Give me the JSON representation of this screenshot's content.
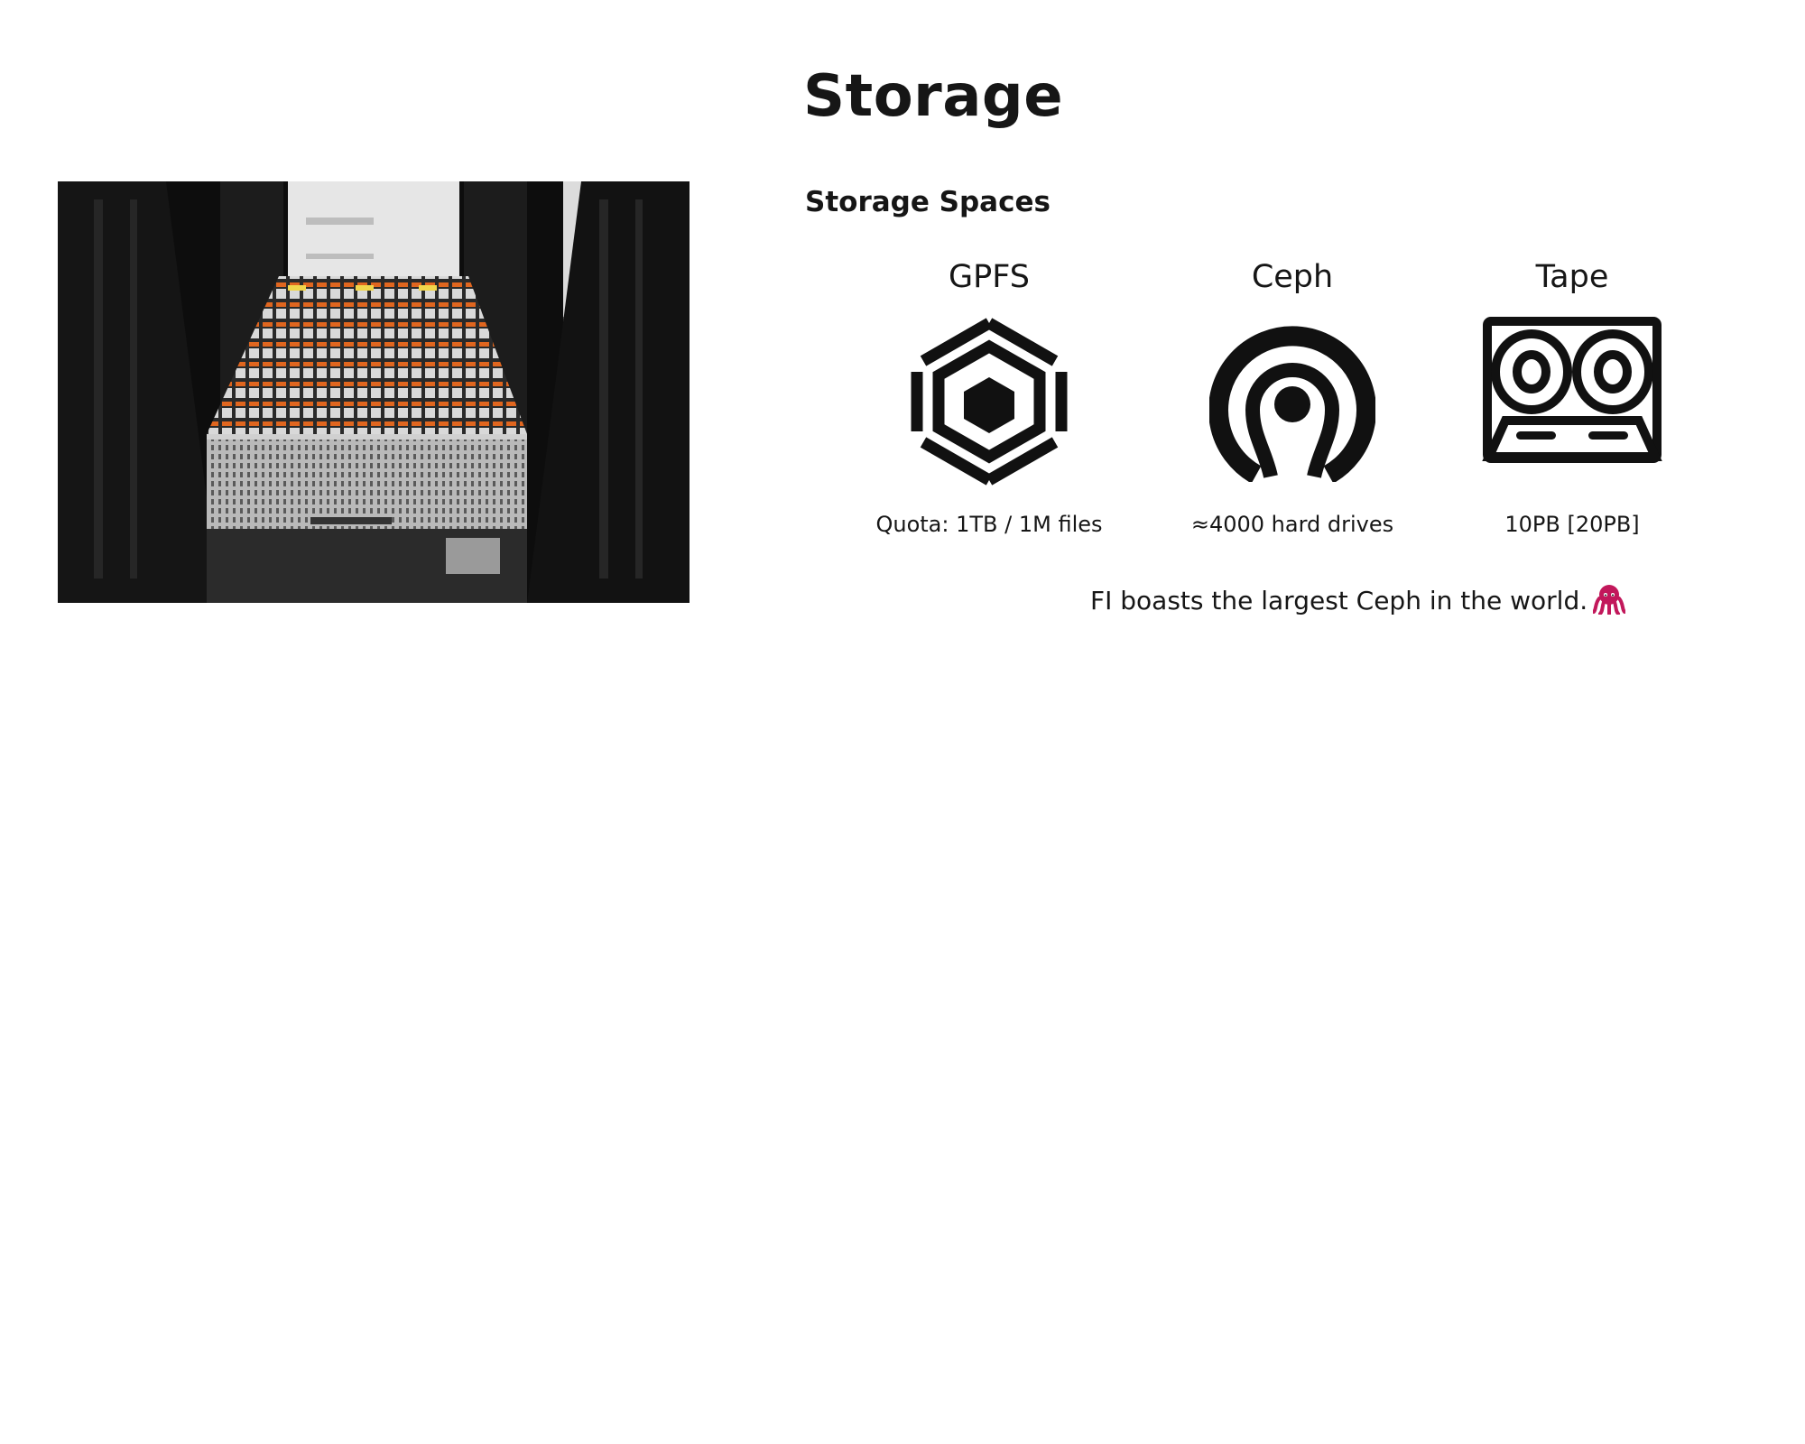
{
  "page": {
    "title": "Storage",
    "subtitle": "Storage Spaces",
    "closing_text": "FI boasts the largest Ceph in the world."
  },
  "photo": {
    "subject": "server-rack-photo"
  },
  "spaces": [
    {
      "name": "GPFS",
      "icon": "gpfs-hexagon-icon",
      "note": "Quota: 1TB / 1M files"
    },
    {
      "name": "Ceph",
      "icon": "ceph-logo-icon",
      "note": "≈4000 hard drives"
    },
    {
      "name": "Tape",
      "icon": "tape-cassette-icon",
      "note": "10PB [20PB]"
    }
  ],
  "emoji": {
    "closing": "octopus-icon"
  },
  "colors": {
    "text": "#161616",
    "icon": "#111111",
    "octopus": "#c2185b"
  }
}
